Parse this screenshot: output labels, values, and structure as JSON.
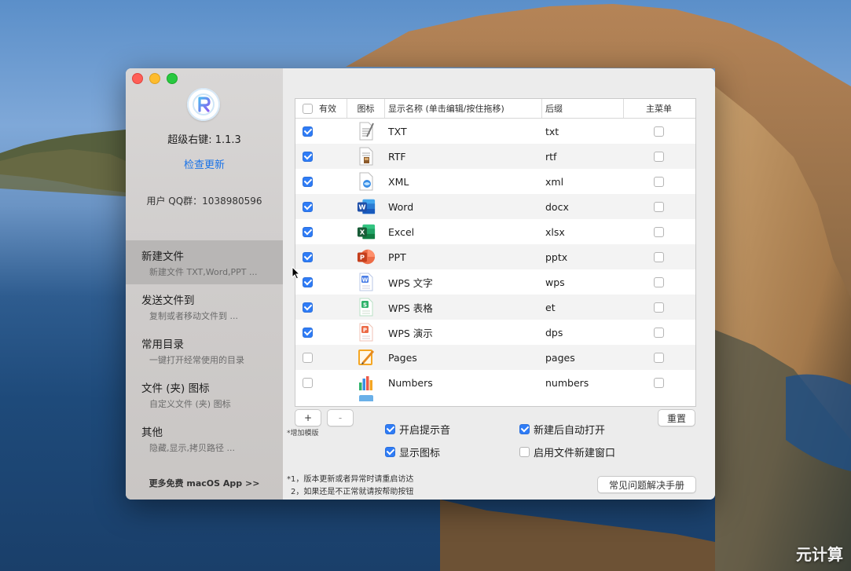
{
  "sidebar": {
    "app_version": "超级右键: 1.1.3",
    "check_update": "检查更新",
    "qq_group": "用户 QQ群：1038980596",
    "items": [
      {
        "title": "新建文件",
        "subtitle": "新建文件 TXT,Word,PPT ..."
      },
      {
        "title": "发送文件到",
        "subtitle": "复制或者移动文件到 ..."
      },
      {
        "title": "常用目录",
        "subtitle": "一键打开经常使用的目录"
      },
      {
        "title": "文件 (夹) 图标",
        "subtitle": "自定义文件 (夹) 图标"
      },
      {
        "title": "其他",
        "subtitle": "隐藏,显示,拷贝路径 ..."
      }
    ],
    "more_apps": "更多免费 macOS App >>"
  },
  "table": {
    "headers": {
      "enabled": "有效",
      "icon": "图标",
      "name": "显示名称 (单击编辑/按住拖移)",
      "suffix": "后缀",
      "main_menu": "主菜单"
    },
    "rows": [
      {
        "enabled": true,
        "icon": "txt-file-icon",
        "name": "TXT",
        "suffix": "txt",
        "main_menu": false
      },
      {
        "enabled": true,
        "icon": "rtf-file-icon",
        "name": "RTF",
        "suffix": "rtf",
        "main_menu": false
      },
      {
        "enabled": true,
        "icon": "xml-file-icon",
        "name": "XML",
        "suffix": "xml",
        "main_menu": false
      },
      {
        "enabled": true,
        "icon": "word-icon",
        "name": "Word",
        "suffix": "docx",
        "main_menu": false
      },
      {
        "enabled": true,
        "icon": "excel-icon",
        "name": "Excel",
        "suffix": "xlsx",
        "main_menu": false
      },
      {
        "enabled": true,
        "icon": "powerpoint-icon",
        "name": "PPT",
        "suffix": "pptx",
        "main_menu": false
      },
      {
        "enabled": true,
        "icon": "wps-writer-icon",
        "name": "WPS 文字",
        "suffix": "wps",
        "main_menu": false
      },
      {
        "enabled": true,
        "icon": "wps-sheets-icon",
        "name": "WPS 表格",
        "suffix": "et",
        "main_menu": false
      },
      {
        "enabled": true,
        "icon": "wps-presentation-icon",
        "name": "WPS 演示",
        "suffix": "dps",
        "main_menu": false
      },
      {
        "enabled": false,
        "icon": "pages-icon",
        "name": "Pages",
        "suffix": "pages",
        "main_menu": false
      },
      {
        "enabled": false,
        "icon": "numbers-icon",
        "name": "Numbers",
        "suffix": "numbers",
        "main_menu": false
      }
    ]
  },
  "controls": {
    "add_label": "+",
    "remove_label": "-",
    "add_hint": "*增加模版",
    "reset_label": "重置",
    "options": [
      {
        "label": "开启提示音",
        "checked": true
      },
      {
        "label": "新建后自动打开",
        "checked": true
      },
      {
        "label": "显示图标",
        "checked": true
      },
      {
        "label": "启用文件新建窗口",
        "checked": false
      }
    ],
    "note1": "*1，版本更新或者异常时请重启访达",
    "note2": "2，如果还是不正常就请按帮助按钮",
    "faq_label": "常见问题解决手册"
  },
  "watermark": "元计算",
  "colors": {
    "accent": "#2f7cf6",
    "link": "#1a73e8"
  }
}
